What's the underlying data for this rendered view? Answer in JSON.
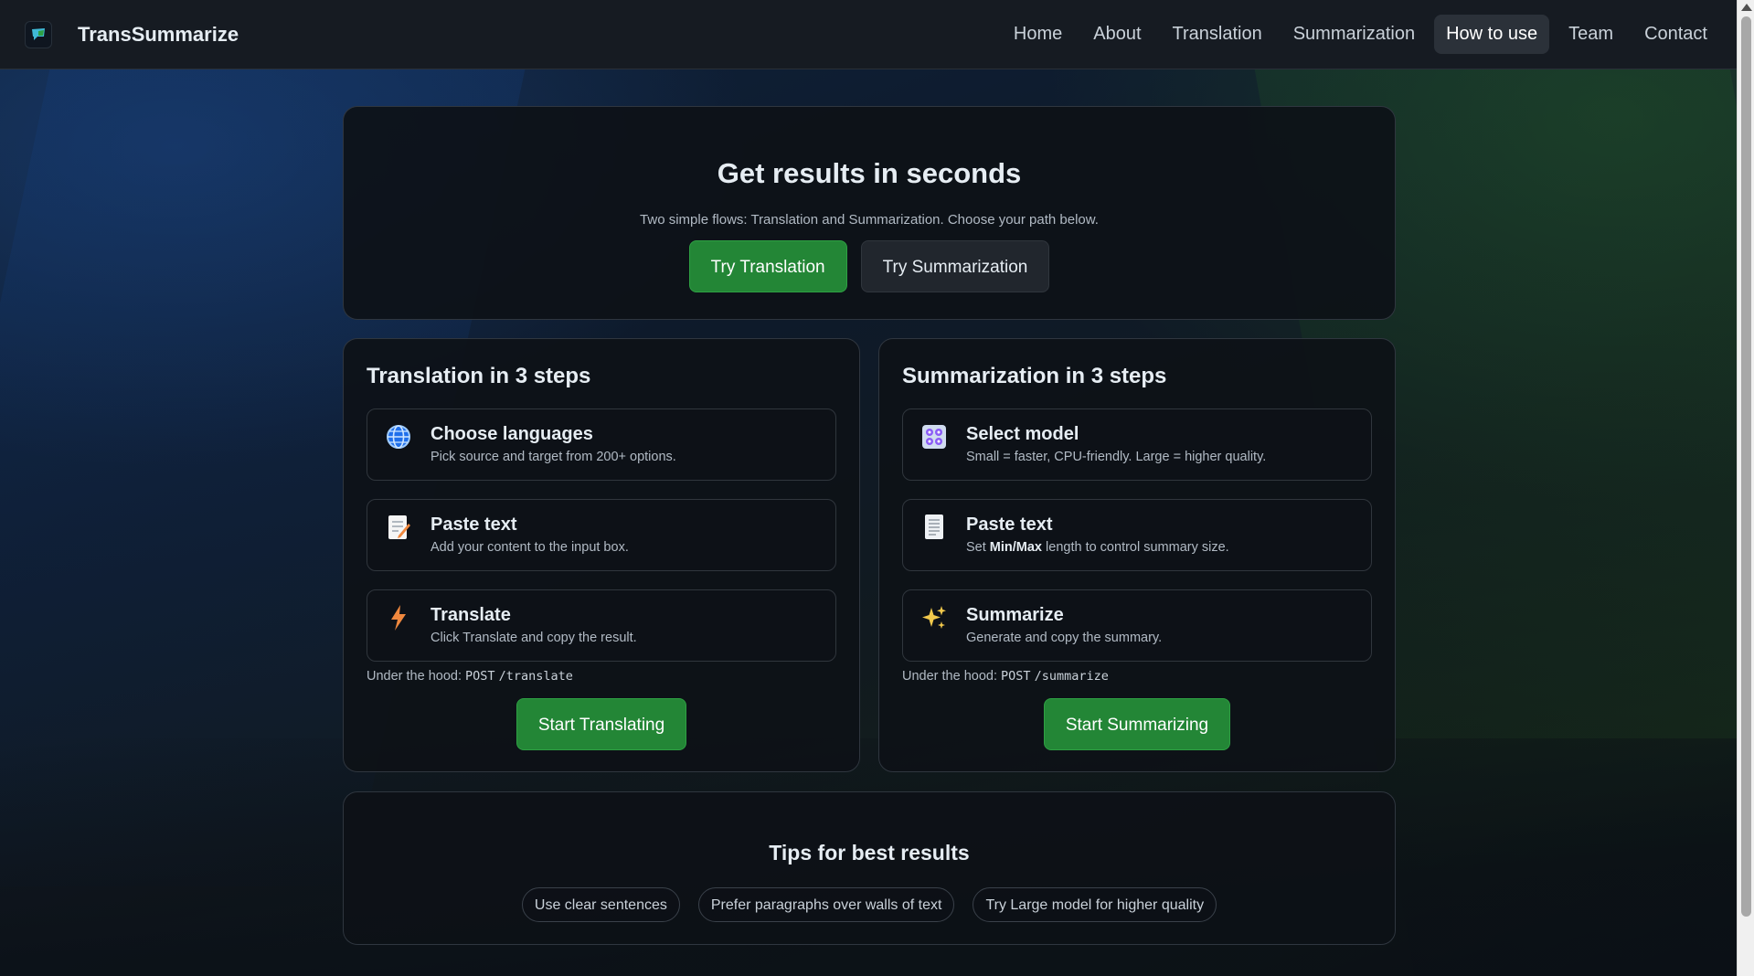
{
  "brand": {
    "name": "TransSummarize",
    "logo_icon": "chat-bubble-icon"
  },
  "nav": {
    "items": [
      {
        "label": "Home"
      },
      {
        "label": "About"
      },
      {
        "label": "Translation"
      },
      {
        "label": "Summarization"
      },
      {
        "label": "How to use",
        "active": true
      },
      {
        "label": "Team"
      },
      {
        "label": "Contact"
      }
    ]
  },
  "hero": {
    "title": "Get results in seconds",
    "subtitle": "Two simple flows: Translation and Summarization. Choose your path below.",
    "primary_button": "Try Translation",
    "secondary_button": "Try Summarization"
  },
  "translation": {
    "title": "Translation in 3 steps",
    "steps": [
      {
        "icon": "globe-icon",
        "title": "Choose languages",
        "desc": "Pick source and target from 200+ options."
      },
      {
        "icon": "memo-icon",
        "title": "Paste text",
        "desc": "Add your content to the input box."
      },
      {
        "icon": "lightning-icon",
        "title": "Translate",
        "desc": "Click Translate and copy the result."
      }
    ],
    "hood_label": "Under the hood:",
    "hood_method": "POST",
    "hood_path": "/translate",
    "cta": "Start Translating"
  },
  "summarization": {
    "title": "Summarization in 3 steps",
    "steps": [
      {
        "icon": "control-knobs-icon",
        "title": "Select model",
        "desc": "Small = faster, CPU-friendly. Large = higher quality."
      },
      {
        "icon": "page-icon",
        "title": "Paste text",
        "desc_prefix": "Set ",
        "desc_bold": "Min/Max",
        "desc_suffix": " length to control summary size."
      },
      {
        "icon": "sparkles-icon",
        "title": "Summarize",
        "desc": "Generate and copy the summary."
      }
    ],
    "hood_label": "Under the hood:",
    "hood_method": "POST",
    "hood_path": "/summarize",
    "cta": "Start Summarizing"
  },
  "tips": {
    "title": "Tips for best results",
    "chips": [
      "Use clear sentences",
      "Prefer paragraphs over walls of text",
      "Try Large model for higher quality"
    ]
  },
  "colors": {
    "accent_green": "#238636",
    "page_bg": "#0d1117",
    "nav_bg": "#161b22",
    "card_border": "#2f363f"
  }
}
